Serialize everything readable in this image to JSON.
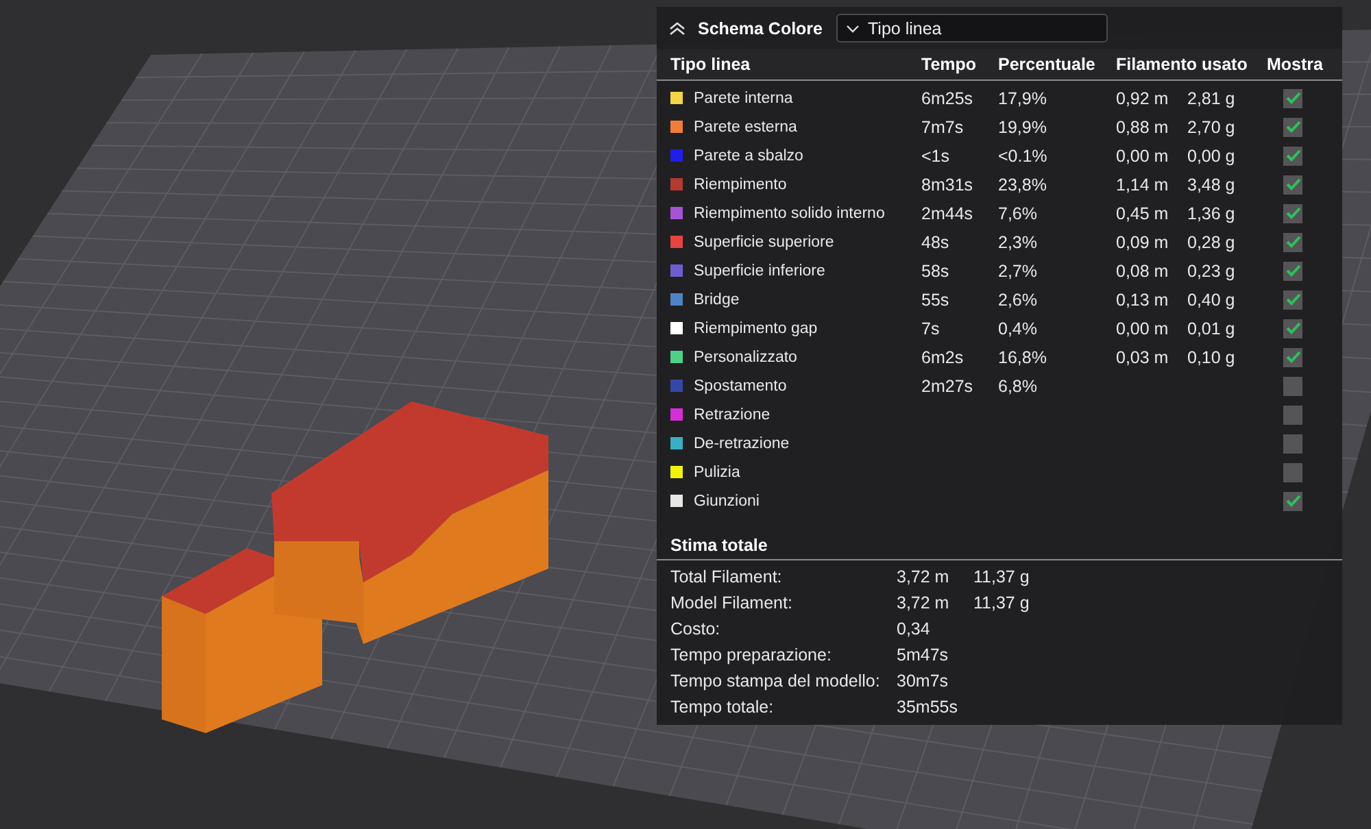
{
  "legend": {
    "title": "Schema Colore",
    "view_mode": "Tipo linea",
    "expanded": true,
    "columns": [
      "Tipo linea",
      "Tempo",
      "Percentuale",
      "Filamento usato",
      "Mostra"
    ],
    "rows": [
      {
        "name": "Parete interna",
        "color": "#f5d547",
        "time": "6m25s",
        "percent": "17,9%",
        "length": "0,92 m",
        "weight": "2,81 g",
        "shown": true
      },
      {
        "name": "Parete esterna",
        "color": "#f07d3a",
        "time": "7m7s",
        "percent": "19,9%",
        "length": "0,88 m",
        "weight": "2,70 g",
        "shown": true
      },
      {
        "name": "Parete a sbalzo",
        "color": "#1f1fe8",
        "time": "<1s",
        "percent": "<0.1%",
        "length": "0,00 m",
        "weight": "0,00 g",
        "shown": true
      },
      {
        "name": "Riempimento",
        "color": "#b53a32",
        "time": "8m31s",
        "percent": "23,8%",
        "length": "1,14 m",
        "weight": "3,48 g",
        "shown": true
      },
      {
        "name": "Riempimento solido interno",
        "color": "#a654d6",
        "time": "2m44s",
        "percent": "7,6%",
        "length": "0,45 m",
        "weight": "1,36 g",
        "shown": true
      },
      {
        "name": "Superficie superiore",
        "color": "#e8433f",
        "time": "48s",
        "percent": "2,3%",
        "length": "0,09 m",
        "weight": "0,28 g",
        "shown": true
      },
      {
        "name": "Superficie inferiore",
        "color": "#6b5fd0",
        "time": "58s",
        "percent": "2,7%",
        "length": "0,08 m",
        "weight": "0,23 g",
        "shown": true
      },
      {
        "name": "Bridge",
        "color": "#4e84c4",
        "time": "55s",
        "percent": "2,6%",
        "length": "0,13 m",
        "weight": "0,40 g",
        "shown": true
      },
      {
        "name": "Riempimento gap",
        "color": "#ffffff",
        "time": "7s",
        "percent": "0,4%",
        "length": "0,00 m",
        "weight": "0,01 g",
        "shown": true
      },
      {
        "name": "Personalizzato",
        "color": "#4fd08a",
        "time": "6m2s",
        "percent": "16,8%",
        "length": "0,03 m",
        "weight": "0,10 g",
        "shown": true
      },
      {
        "name": "Spostamento",
        "color": "#3548a8",
        "time": "2m27s",
        "percent": "6,8%",
        "shown": false
      },
      {
        "name": "Retrazione",
        "color": "#d42ed6",
        "shown": false
      },
      {
        "name": "De-retrazione",
        "color": "#3aaec4",
        "shown": false
      },
      {
        "name": "Pulizia",
        "color": "#f2f20f",
        "shown": false
      },
      {
        "name": "Giunzioni",
        "color": "#e6e6e6",
        "shown": true
      }
    ]
  },
  "estimate": {
    "title": "Stima totale",
    "rows": [
      {
        "label": "Total Filament:",
        "value": "3,72 m",
        "value_2": "11,37 g"
      },
      {
        "label": "Model Filament:",
        "value": "3,72 m",
        "value_2": "11,37 g"
      },
      {
        "label": "Costo:",
        "value": "0,34"
      },
      {
        "label": "Tempo preparazione:",
        "value": "5m47s"
      },
      {
        "label": "Tempo stampa del modello:",
        "value": "30m7s"
      },
      {
        "label": "Tempo totale:",
        "value": "35m55s"
      }
    ]
  }
}
